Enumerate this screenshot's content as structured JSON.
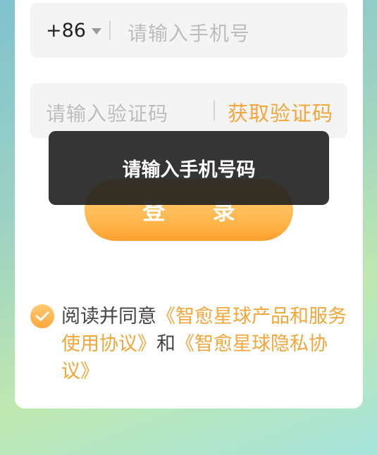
{
  "phone": {
    "country_code": "+86",
    "placeholder": "请输入手机号"
  },
  "code": {
    "placeholder": "请输入验证码",
    "get_code_label": "获取验证码"
  },
  "login": {
    "label": "登 录"
  },
  "toast": {
    "message": "请输入手机号码"
  },
  "agreement": {
    "checked": true,
    "prefix": "阅读并同意",
    "service_link": "《智愈星球产品和服务使用协议》",
    "and_text": "和",
    "privacy_link": "《智愈星球隐私协议》"
  },
  "colors": {
    "accent": "#f5a63b",
    "toast_bg": "#191919",
    "field_bg": "#f4f4f4"
  }
}
